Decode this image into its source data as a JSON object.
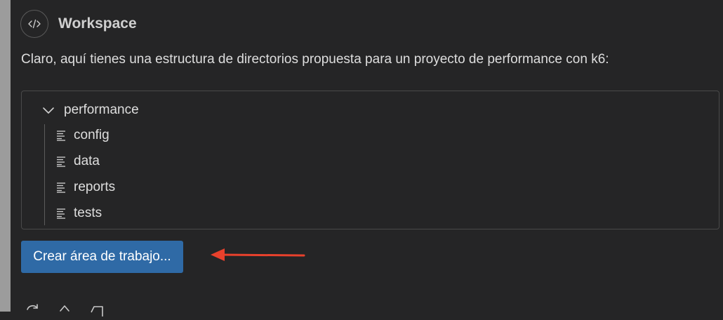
{
  "header": {
    "title": "Workspace",
    "avatar_icon": "code-icon"
  },
  "message": "Claro, aquí tienes una estructura de directorios propuesta para un proyecto de performance con k6:",
  "tree": {
    "root": {
      "label": "performance",
      "expanded": true,
      "icon": "chevron-down-icon"
    },
    "children": [
      {
        "label": "config",
        "icon": "file-lines-icon"
      },
      {
        "label": "data",
        "icon": "file-lines-icon"
      },
      {
        "label": "reports",
        "icon": "file-lines-icon"
      },
      {
        "label": "tests",
        "icon": "file-lines-icon"
      }
    ]
  },
  "create_button": {
    "label": "Crear área de trabajo..."
  },
  "annotation": {
    "arrow_color": "#e8412c"
  },
  "colors": {
    "background": "#252526",
    "button": "#2f6aa6",
    "text": "#dedede"
  },
  "bottom_actions": [
    {
      "icon": "refresh-icon"
    },
    {
      "icon": "share-icon"
    },
    {
      "icon": "copy-icon"
    }
  ]
}
